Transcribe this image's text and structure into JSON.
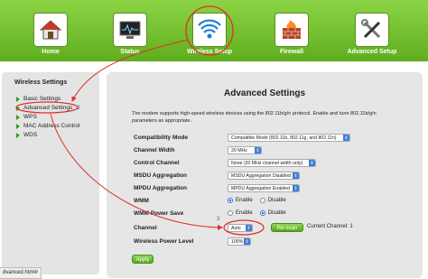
{
  "nav": {
    "items": [
      {
        "label": "Home",
        "icon": "house-icon"
      },
      {
        "label": "Status",
        "icon": "monitor-icon"
      },
      {
        "label": "Wireless Setup",
        "icon": "wifi-icon"
      },
      {
        "label": "Firewall",
        "icon": "firewall-icon"
      },
      {
        "label": "Advanced Setup",
        "icon": "tools-icon"
      }
    ]
  },
  "sidebar": {
    "title": "Wireless Settings",
    "items": [
      {
        "label": "Basic Settings"
      },
      {
        "label": "Advanced Settings"
      },
      {
        "label": "WPS"
      },
      {
        "label": "MAC Address Control"
      },
      {
        "label": "WDS"
      }
    ],
    "annotation": "2"
  },
  "main": {
    "title": "Advanced Settings",
    "description": "The modem supports high-speed wireless devices using the 802.11b/g/n protocol. Enable and tune 802.11b/g/n parameters as appropriate.",
    "fields": {
      "compatibility_mode": {
        "label": "Compatibility Mode",
        "value": "Compatible Mode (802.11b, 802.11g, and 802.11n)"
      },
      "channel_width": {
        "label": "Channel Width",
        "value": "20 MHz"
      },
      "control_channel": {
        "label": "Control Channel",
        "value": "None (20 MHz channel width only)"
      },
      "msdu": {
        "label": "MSDU Aggregation",
        "value": "MSDU Aggregation Disabled"
      },
      "mpdu": {
        "label": "MPDU Aggregation",
        "value": "MPDU Aggregation Enabled"
      },
      "wmm": {
        "label": "WMM",
        "on": "Enable",
        "off": "Disable"
      },
      "wmm_power_save": {
        "label": "WMM Power Save",
        "on": "Enable",
        "off": "Disable"
      },
      "channel": {
        "label": "Channel",
        "value": "Auto",
        "rescan": "Re-scan",
        "current": "Current Channel: 1",
        "annotation": "3"
      },
      "power_level": {
        "label": "Wireless Power Level",
        "value": "100%"
      }
    },
    "apply": "Apply"
  },
  "statusbar": {
    "url": "dvanced.html#"
  },
  "colors": {
    "nav_green": "#6dbb25",
    "annotation_red": "#e0302a",
    "select_blue": "#3d7ed8"
  }
}
